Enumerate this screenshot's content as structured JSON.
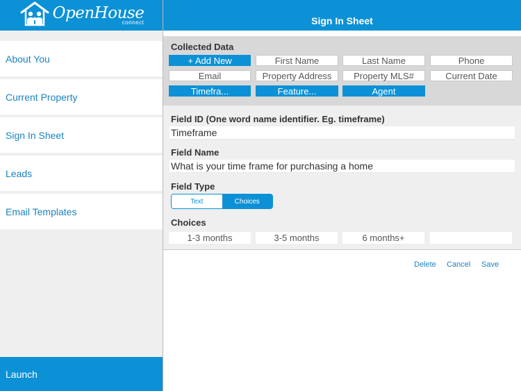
{
  "sidebar": {
    "logo": {
      "main": "OpenHouse",
      "sub": "connect"
    },
    "items": [
      {
        "label": "About You"
      },
      {
        "label": "Current Property"
      },
      {
        "label": "Sign In Sheet"
      },
      {
        "label": "Leads"
      },
      {
        "label": "Email Templates"
      }
    ],
    "launch_label": "Launch"
  },
  "header": {
    "title": "Sign In Sheet"
  },
  "collected_data": {
    "title": "Collected Data",
    "chips": [
      {
        "label": "+ Add New",
        "active": true
      },
      {
        "label": "First Name",
        "active": false
      },
      {
        "label": "Last Name",
        "active": false
      },
      {
        "label": "Phone",
        "active": false
      },
      {
        "label": "Email",
        "active": false
      },
      {
        "label": "Property Address",
        "active": false
      },
      {
        "label": "Property MLS#",
        "active": false
      },
      {
        "label": "Current Date",
        "active": false
      },
      {
        "label": "Timefra...",
        "active": true
      },
      {
        "label": "Feature...",
        "active": true
      },
      {
        "label": "Agent",
        "active": true
      }
    ]
  },
  "form": {
    "field_id_label": "Field ID (One word name identifier. Eg. timeframe)",
    "field_id_value": "Timeframe",
    "field_name_label": "Field Name",
    "field_name_value": "What is your time frame for purchasing a home",
    "field_type_label": "Field Type",
    "field_type_options": [
      "Text",
      "Choices"
    ],
    "field_type_selected": "Choices",
    "choices_label": "Choices",
    "choices": [
      "1-3 months",
      "3-5 months",
      "6 months+",
      ""
    ]
  },
  "actions": {
    "delete": "Delete",
    "cancel": "Cancel",
    "save": "Save"
  },
  "colors": {
    "brand": "#0c91d6",
    "link": "#1a83bf",
    "panel": "#d8d8d8",
    "background": "#efefef"
  },
  "icons": {
    "logo": "house-family-icon"
  }
}
